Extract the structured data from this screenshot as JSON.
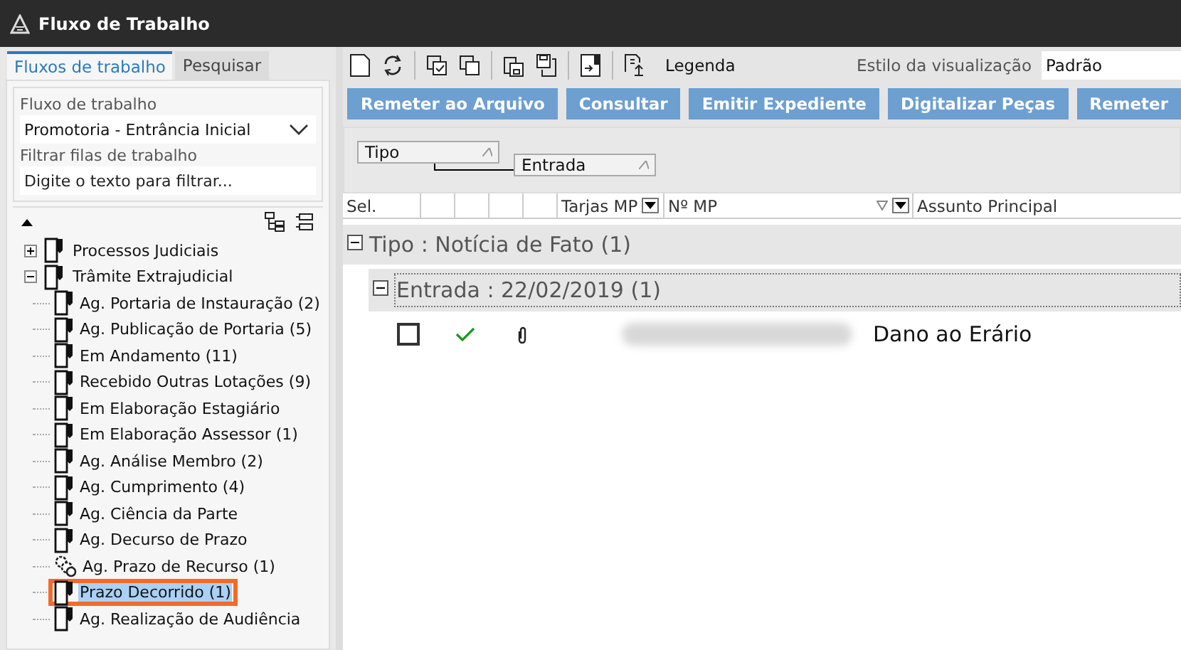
{
  "window": {
    "title": "Fluxo de Trabalho"
  },
  "tabs": [
    {
      "label": "Fluxos de trabalho",
      "selected": true
    },
    {
      "label": "Pesquisar",
      "selected": false
    }
  ],
  "workflow": {
    "label": "Fluxo de trabalho",
    "value": "Promotoria - Entrância Inicial"
  },
  "filter": {
    "label": "Filtrar filas de trabalho",
    "placeholder": "Digite o texto para filtrar..."
  },
  "tree": [
    {
      "label": "Processos Judiciais",
      "expanded": false,
      "selected": false,
      "kind": "queue"
    },
    {
      "label": "Trâmite Extrajudicial",
      "expanded": true,
      "selected": false,
      "kind": "queue",
      "children": [
        {
          "label": "Ag. Portaria de Instauração (2)",
          "selected": false,
          "kind": "queue"
        },
        {
          "label": "Ag. Publicação de Portaria (5)",
          "selected": false,
          "kind": "queue"
        },
        {
          "label": "Em Andamento (11)",
          "selected": false,
          "kind": "queue"
        },
        {
          "label": "Recebido Outras Lotações (9)",
          "selected": false,
          "kind": "queue"
        },
        {
          "label": "Em Elaboração Estagiário",
          "selected": false,
          "kind": "queue"
        },
        {
          "label": "Em Elaboração Assessor (1)",
          "selected": false,
          "kind": "queue"
        },
        {
          "label": "Ag. Análise Membro (2)",
          "selected": false,
          "kind": "queue"
        },
        {
          "label": "Ag. Cumprimento (4)",
          "selected": false,
          "kind": "queue"
        },
        {
          "label": "Ag. Ciência da Parte",
          "selected": false,
          "kind": "queue"
        },
        {
          "label": "Ag. Decurso de Prazo",
          "selected": false,
          "kind": "queue"
        },
        {
          "label": "Ag. Prazo de Recurso (1)",
          "selected": false,
          "kind": "timer"
        },
        {
          "label": "Prazo Decorrido (1)",
          "selected": true,
          "kind": "queue"
        },
        {
          "label": "Ag. Realização de Audiência",
          "selected": false,
          "kind": "queue"
        }
      ]
    }
  ],
  "toolbar": {
    "legend": "Legenda",
    "view_style_label": "Estilo da visualização",
    "view_style_value": "Padrão"
  },
  "actions": [
    "Remeter ao Arquivo",
    "Consultar",
    "Emitir Expediente",
    "Digitalizar Peças",
    "Remeter"
  ],
  "group_by": [
    "Tipo",
    "Entrada"
  ],
  "table": {
    "columns": [
      "Sel.",
      "",
      "",
      "",
      "",
      "Tarjas MP",
      "Nº MP",
      "Assunto Principal"
    ],
    "groups": [
      {
        "label": "Tipo : Notícia de Fato  (1)",
        "expanded": true,
        "children": [
          {
            "label": "Entrada : 22/02/2019  (1)",
            "expanded": true,
            "rows": [
              {
                "checked": false,
                "done": true,
                "attachment": true,
                "subject": "Dano ao Erário"
              }
            ]
          }
        ]
      }
    ]
  }
}
